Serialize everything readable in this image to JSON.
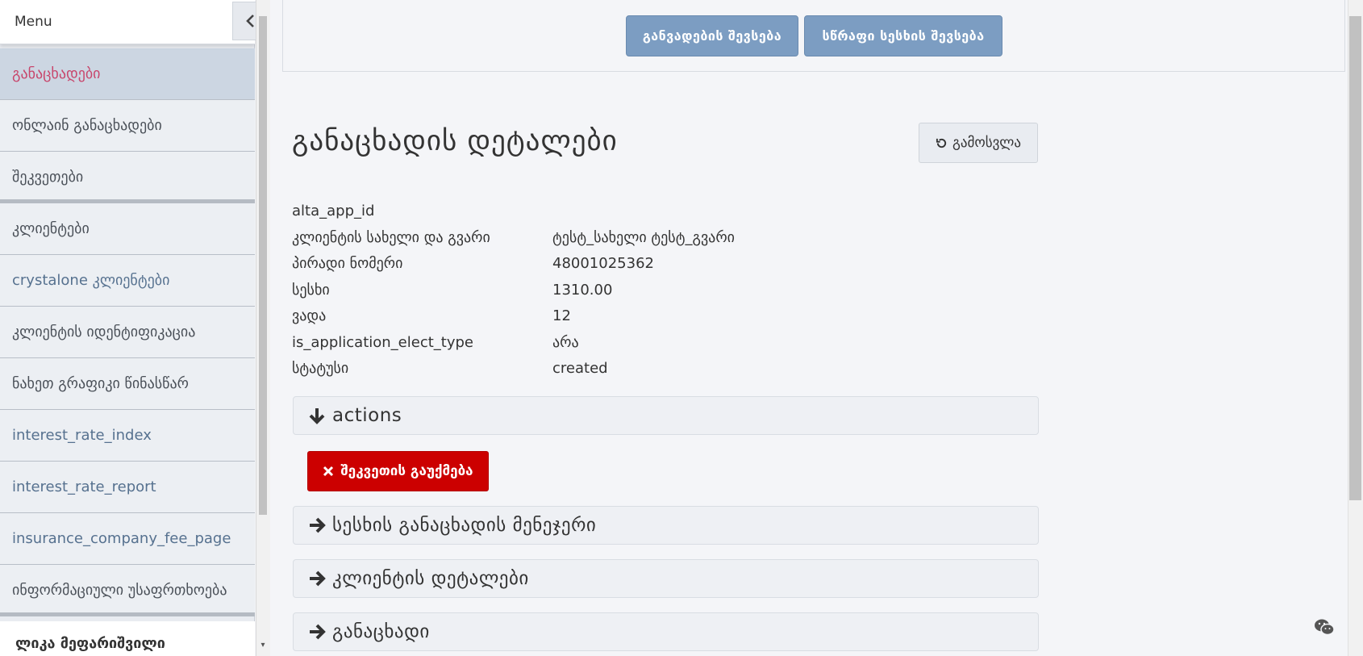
{
  "sidebar": {
    "title": "Menu",
    "items": [
      {
        "label": "განაცხადები"
      },
      {
        "label": "ონლაინ განაცხადები"
      },
      {
        "label": "შეკვეთები"
      },
      {
        "label": "კლიენტები"
      },
      {
        "label": "crystalone კლიენტები"
      },
      {
        "label": "კლიენტის იდენტიფიკაცია"
      },
      {
        "label": "ნახეთ გრაფიკი წინასწარ"
      },
      {
        "label": "interest_rate_index"
      },
      {
        "label": "interest_rate_report"
      },
      {
        "label": "insurance_company_fee_page"
      },
      {
        "label": "ინფორმაციული უსაფრთხოება"
      }
    ],
    "user": "ლიკა მეფარიშვილი"
  },
  "topbar": {
    "application_search": "განვადების შევსება",
    "quick_loan": "სწრაფი სესხის შევსება"
  },
  "main": {
    "title": "განაცხადის დეტალები",
    "exit_label": "გამოსვლა",
    "details": [
      {
        "key": "alta_app_id",
        "value": ""
      },
      {
        "key": "კლიენტის სახელი და გვარი",
        "value": "ტესტ_სახელი ტესტ_გვარი"
      },
      {
        "key": "პირადი ნომერი",
        "value": "48001025362"
      },
      {
        "key": "სესხი",
        "value": "1310.00"
      },
      {
        "key": "ვადა",
        "value": "12"
      },
      {
        "key": "is_application_elect_type",
        "value": "არა"
      },
      {
        "key": "სტატუსი",
        "value": "created"
      }
    ],
    "panels": {
      "actions": "actions",
      "manager": "სესხის განაცხადის მენეჯერი",
      "client_details": "კლიენტის დეტალები",
      "application": "განაცხადი"
    },
    "cancel_order_label": "შეკვეთის გაუქმება"
  },
  "colors": {
    "active_item_bg": "#ccd6e2",
    "active_item_text": "#c8466c",
    "primary_button": "#7c9dc2",
    "danger_button": "#cc0000"
  }
}
